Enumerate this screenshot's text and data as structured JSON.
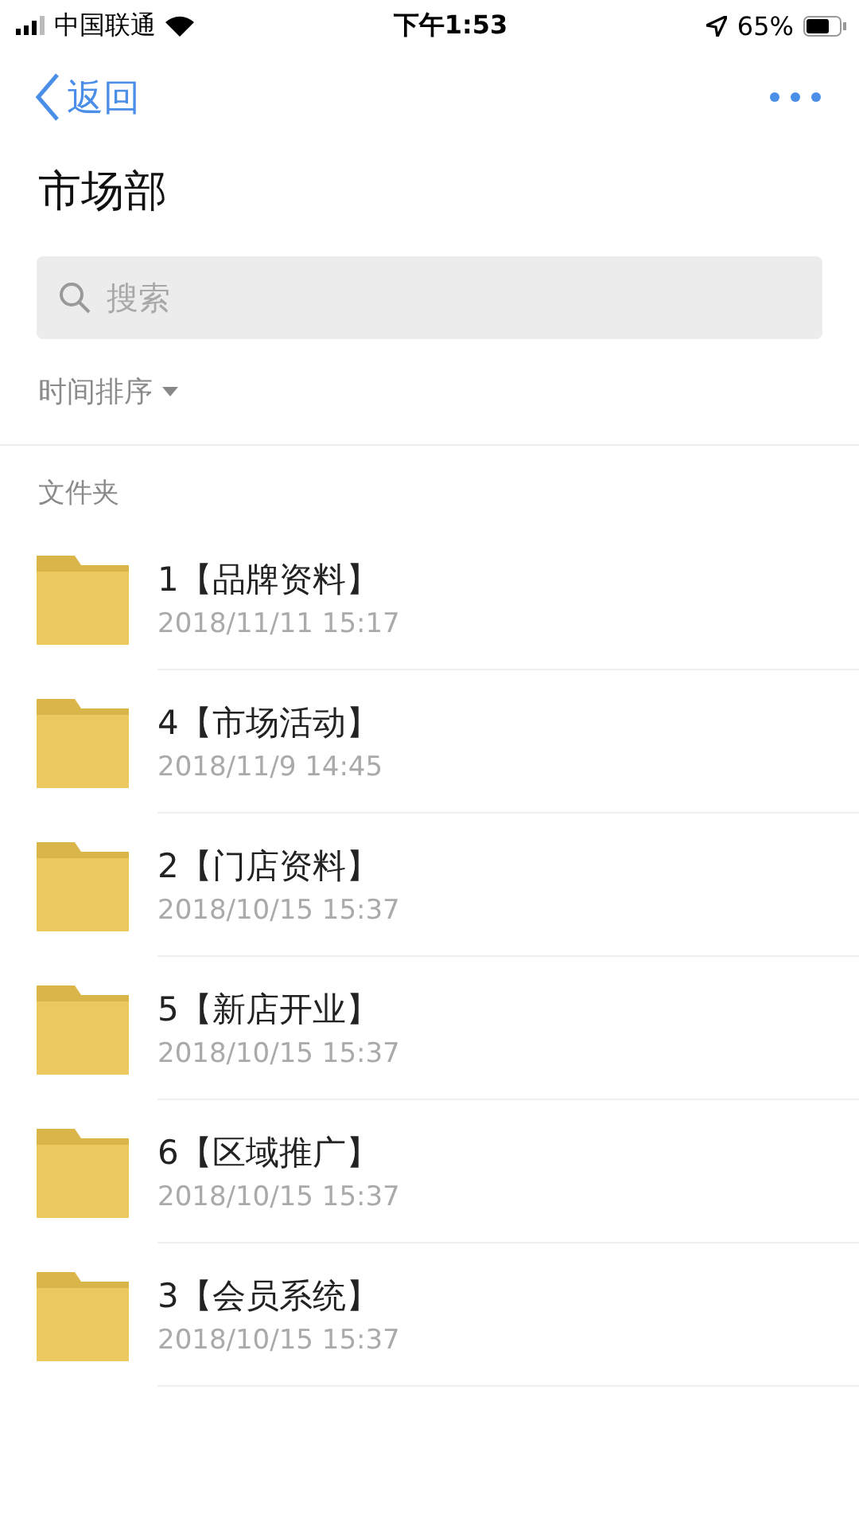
{
  "status_bar": {
    "carrier": "中国联通",
    "time": "下午1:53",
    "battery": "65%"
  },
  "nav": {
    "back": "返回"
  },
  "title": "市场部",
  "search": {
    "placeholder": "搜索"
  },
  "sort": {
    "label": "时间排序"
  },
  "section": "文件夹",
  "folders": [
    {
      "name": "1【品牌资料】",
      "date": "2018/11/11 15:17"
    },
    {
      "name": "4【市场活动】",
      "date": "2018/11/9 14:45"
    },
    {
      "name": "2【门店资料】",
      "date": "2018/10/15 15:37"
    },
    {
      "name": "5【新店开业】",
      "date": "2018/10/15 15:37"
    },
    {
      "name": "6【区域推广】",
      "date": "2018/10/15 15:37"
    },
    {
      "name": "3【会员系统】",
      "date": "2018/10/15 15:37"
    }
  ]
}
